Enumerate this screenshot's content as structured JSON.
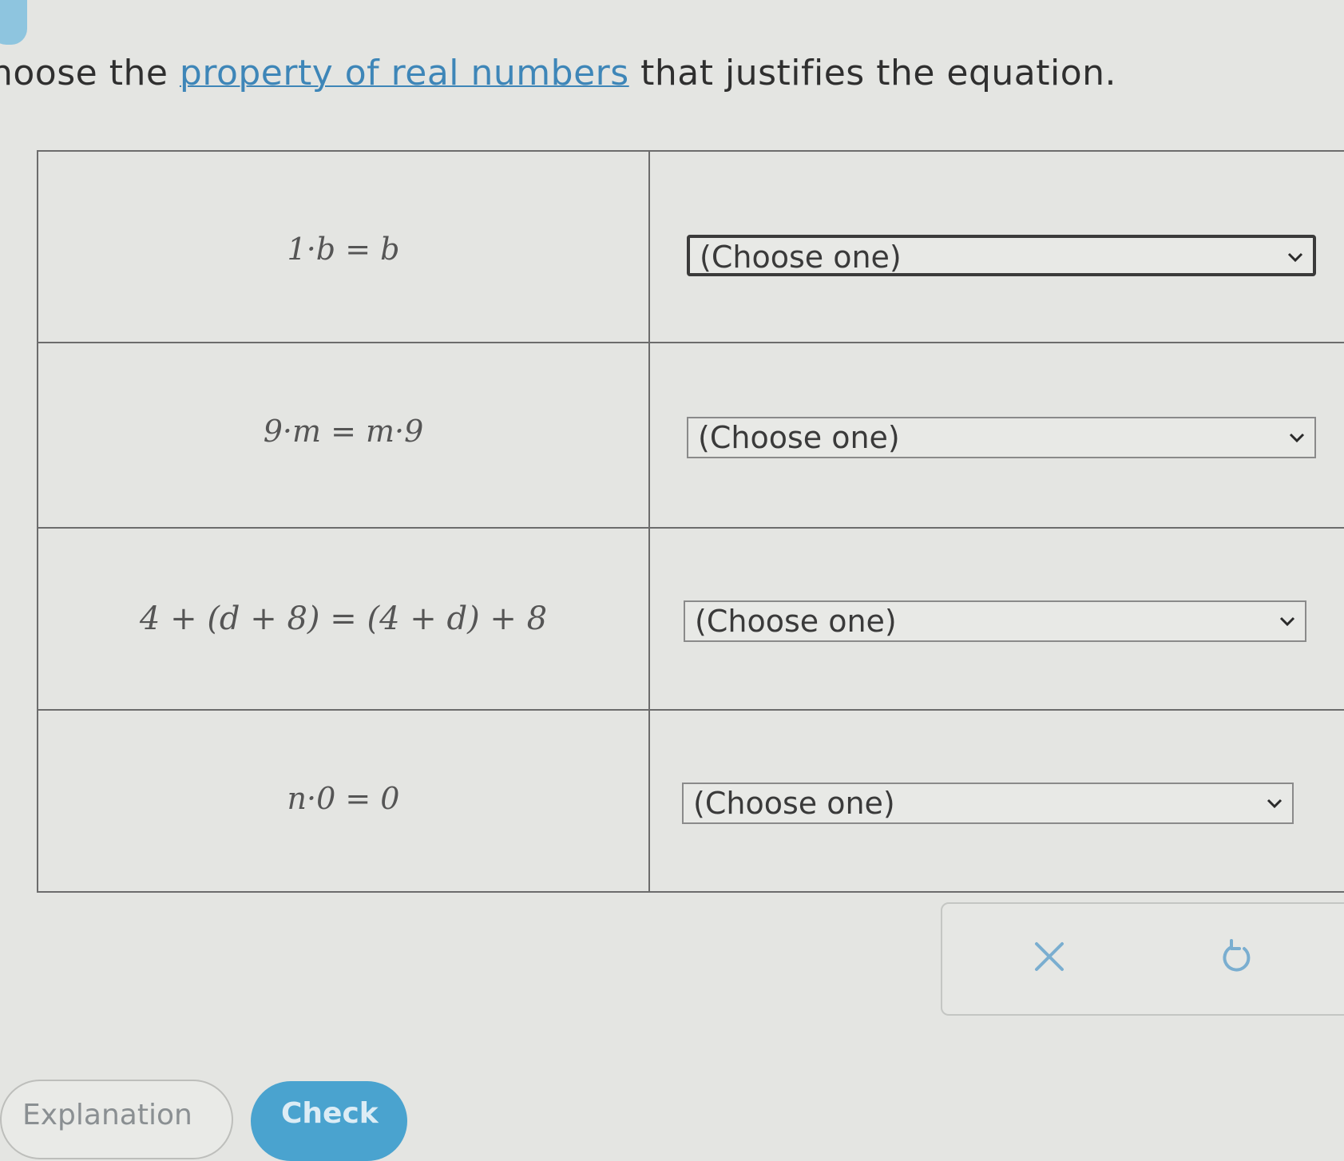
{
  "prompt": {
    "before": "hoose the ",
    "link": "property of real numbers",
    "after": " that justifies the equation."
  },
  "rows": [
    {
      "equation": "1·b = b",
      "select_value": "(Choose one)"
    },
    {
      "equation": "9·m = m·9",
      "select_value": "(Choose one)"
    },
    {
      "equation": "4 + (d + 8) = (4 + d) + 8",
      "select_value": "(Choose one)"
    },
    {
      "equation": "n·0 = 0",
      "select_value": "(Choose one)"
    }
  ],
  "actions": {
    "clear_icon": "close-icon",
    "undo_icon": "undo-icon"
  },
  "buttons": {
    "explanation": "Explanation",
    "check": "Check"
  },
  "colors": {
    "link": "#3e86b8",
    "check_button": "#4aa3cf",
    "icon": "#7aaed0"
  }
}
